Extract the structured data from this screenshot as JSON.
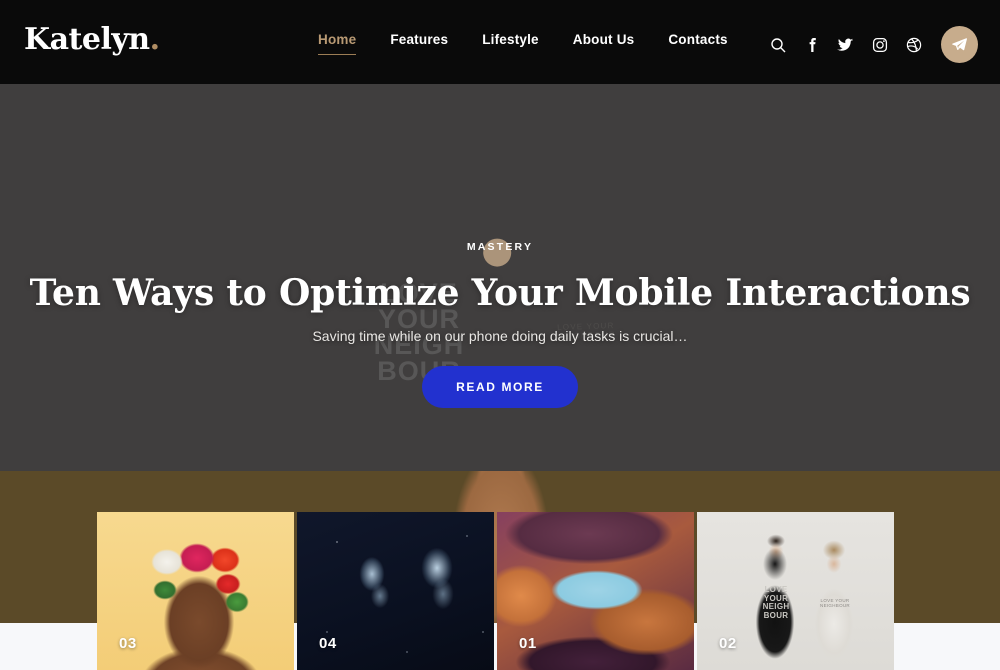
{
  "site": {
    "logo_text": "Katelyn",
    "logo_dot": "."
  },
  "nav": {
    "items": [
      {
        "label": "Home",
        "active": true
      },
      {
        "label": "Features",
        "active": false
      },
      {
        "label": "Lifestyle",
        "active": false
      },
      {
        "label": "About Us",
        "active": false
      },
      {
        "label": "Contacts",
        "active": false
      }
    ]
  },
  "header_icons": [
    {
      "name": "search-icon"
    },
    {
      "name": "facebook-icon"
    },
    {
      "name": "twitter-icon"
    },
    {
      "name": "instagram-icon"
    },
    {
      "name": "dribbble-icon"
    },
    {
      "name": "send-icon"
    }
  ],
  "hero": {
    "category": "MASTERY",
    "title": "Ten Ways to Optimize Your Mobile Interactions",
    "subtitle": "Saving time while on our phone doing daily tasks is crucial…",
    "cta_label": "READ MORE",
    "photo_hoodie_text": "LOVE YOUR NEIGH BOUR",
    "photo_tee_text": "LOVE YOUR NEIGHBOUR"
  },
  "cards": [
    {
      "number": "03",
      "subject": "woman-with-flower-crown"
    },
    {
      "number": "04",
      "subject": "jellyfish"
    },
    {
      "number": "01",
      "subject": "slot-canyon"
    },
    {
      "number": "02",
      "subject": "couple-in-hoodies"
    }
  ],
  "card4_text": {
    "hoodie": "LOVE YOUR NEIGH BOUR",
    "tee": "LOVE YOUR NEIGHBOUR"
  },
  "colors": {
    "header_bg": "#0a0a0a",
    "accent_tan": "#b99a74",
    "send_button_bg": "#c7ac8c",
    "hero_overlay": "#4a4848",
    "cta_blue": "#2231cf",
    "band_olive": "#5b4a28",
    "page_bg": "#f7f8fa"
  }
}
